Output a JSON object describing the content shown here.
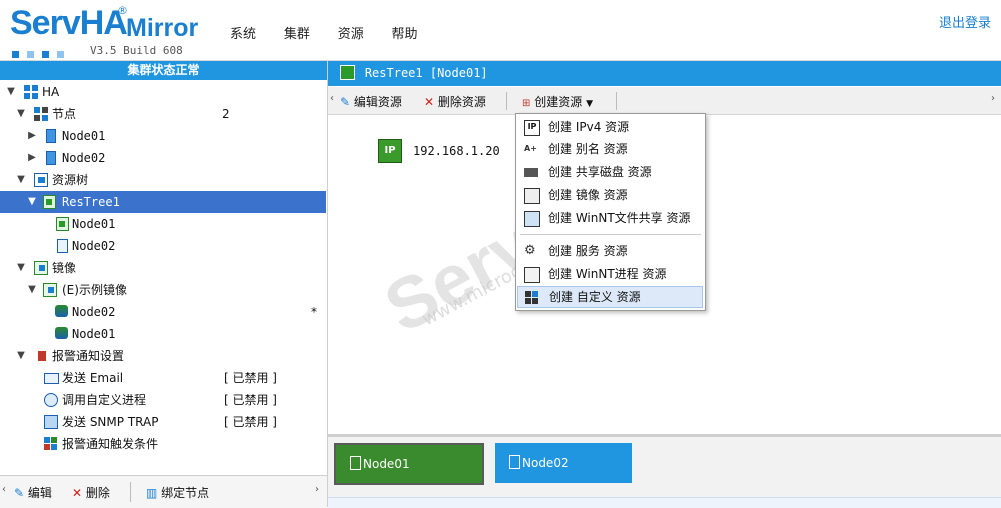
{
  "header": {
    "brand": "ServHA",
    "brand_suffix": "Mirror",
    "reg_mark": "®",
    "version": "V3.5 Build 608",
    "menu": [
      "系统",
      "集群",
      "资源",
      "帮助"
    ],
    "logout": "退出登录"
  },
  "left": {
    "status_title": "集群状态正常",
    "tree": {
      "ha": "HA",
      "nodes_label": "节点",
      "nodes_count": "2",
      "node1": "Node01",
      "node2": "Node02",
      "restree_label": "资源树",
      "restree1": "ResTree1",
      "rt_node1": "Node01",
      "rt_node2": "Node02",
      "mirror_label": "镜像",
      "mirror_example": "(E)示例镜像",
      "mirror_node2": "Node02",
      "mirror_node2_star": "*",
      "mirror_node1": "Node01",
      "alarm_label": "报警通知设置",
      "alarm_email": "发送 Email",
      "alarm_email_status": "[ 已禁用 ]",
      "alarm_proc": "调用自定义进程",
      "alarm_proc_status": "[ 已禁用 ]",
      "alarm_snmp": "发送 SNMP TRAP",
      "alarm_snmp_status": "[ 已禁用 ]",
      "alarm_trigger": "报警通知触发条件"
    },
    "footer": {
      "edit": "编辑",
      "delete": "删除",
      "bind": "绑定节点"
    }
  },
  "right": {
    "title": "ResTree1 [Node01]",
    "toolbar": {
      "edit": "编辑资源",
      "delete": "删除资源",
      "create": "创建资源"
    },
    "resource": {
      "icon_text": "IP",
      "label": "192.168.1.20"
    },
    "dropdown": [
      "创建 IPv4 资源",
      "创建 别名 资源",
      "创建 共享磁盘 资源",
      "创建 镜像 资源",
      "创建 WinNT文件共享 资源",
      "创建 服务 资源",
      "创建 WinNT进程 资源",
      "创建 自定义 资源"
    ],
    "node_tabs": [
      "Node01",
      "Node02"
    ],
    "node_tab_colors": [
      "#3a8a2e",
      "#2196e0"
    ]
  },
  "watermark": {
    "brand": "ServHA",
    "site": "www.microcolor.cn"
  },
  "colors": {
    "accent": "#2196e0",
    "selected_row": "#3b73cc",
    "delete_red": "#d0201a"
  }
}
